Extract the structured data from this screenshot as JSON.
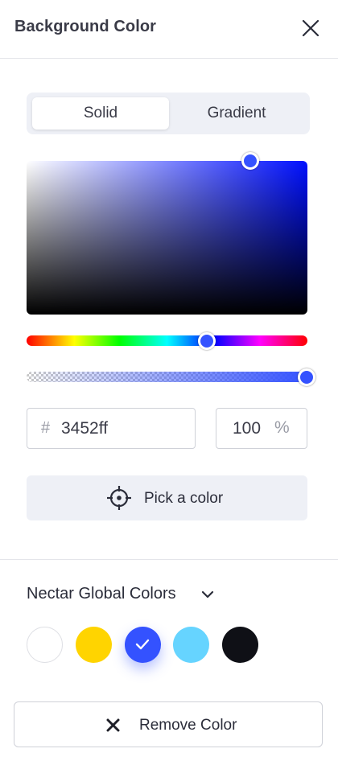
{
  "panel": {
    "title": "Background Color",
    "close_icon": "close-icon"
  },
  "tabs": [
    {
      "label": "Solid",
      "active": true
    },
    {
      "label": "Gradient",
      "active": false
    }
  ],
  "picker": {
    "color_hex": "#3452ff",
    "hue_position": 0.64,
    "alpha_position": 1.0,
    "saturation": 0.8,
    "brightness": 1.0
  },
  "fields": {
    "hex_prefix": "#",
    "hex_value": "3452ff",
    "alpha_value": "100",
    "alpha_unit": "%"
  },
  "pick_button": {
    "label": "Pick a color",
    "icon": "crosshair-icon"
  },
  "global_colors": {
    "title": "Nectar Global Colors",
    "icon": "chevron-down-icon",
    "swatches": [
      {
        "color": "#ffffff",
        "selected": false
      },
      {
        "color": "#ffd400",
        "selected": false
      },
      {
        "color": "#3452ff",
        "selected": true
      },
      {
        "color": "#66d4ff",
        "selected": false
      },
      {
        "color": "#0f1016",
        "selected": false
      }
    ]
  },
  "remove_button": {
    "label": "Remove Color",
    "icon": "x-icon"
  }
}
